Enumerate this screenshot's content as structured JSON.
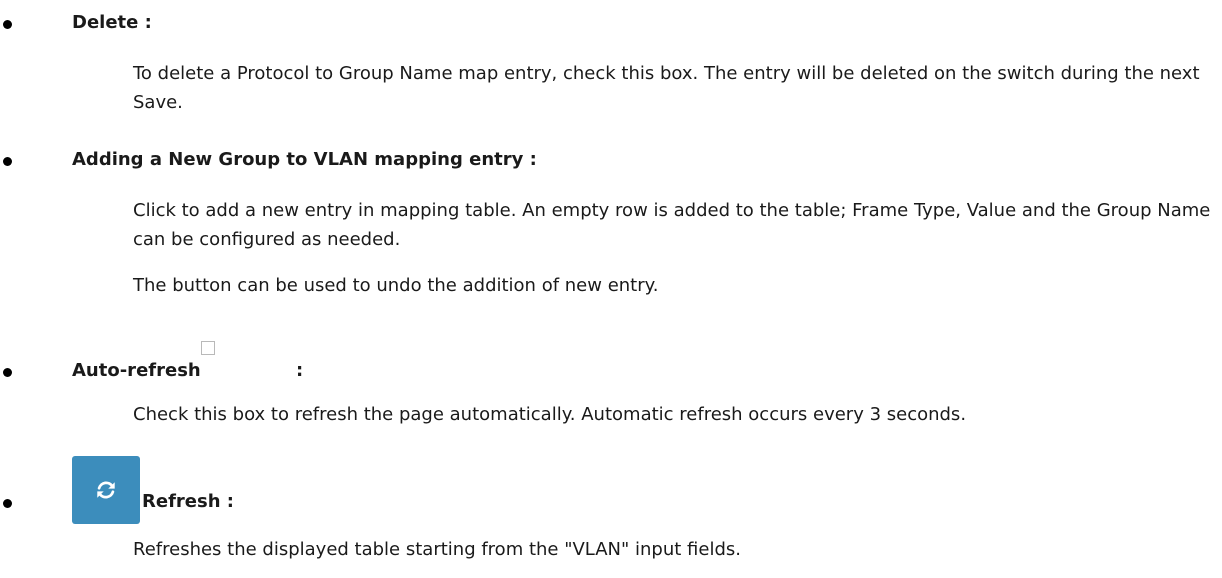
{
  "sections": [
    {
      "title": "Delete :",
      "paragraphs": [
        "To delete a Protocol to Group Name map entry, check this box. The entry will be deleted on the switch during the next Save."
      ]
    },
    {
      "title": "Adding a New Group to VLAN mapping entry :",
      "paragraphs": [
        "Click to add a new entry in mapping table. An empty row is added to the table; Frame Type, Value and the Group Name can be configured as needed.",
        "The button can be used to undo the addition of new entry."
      ]
    },
    {
      "title": "Auto-refresh",
      "title_suffix": ":",
      "checkbox_checked": false,
      "paragraphs": [
        "Check this box to refresh the page automatically. Automatic refresh occurs every 3 seconds."
      ]
    },
    {
      "title": "Refresh :",
      "icon": "refresh-icon",
      "button_color": "#3c8dbc",
      "paragraphs": [
        "Refreshes the displayed table starting from the \"VLAN\" input fields."
      ]
    }
  ]
}
